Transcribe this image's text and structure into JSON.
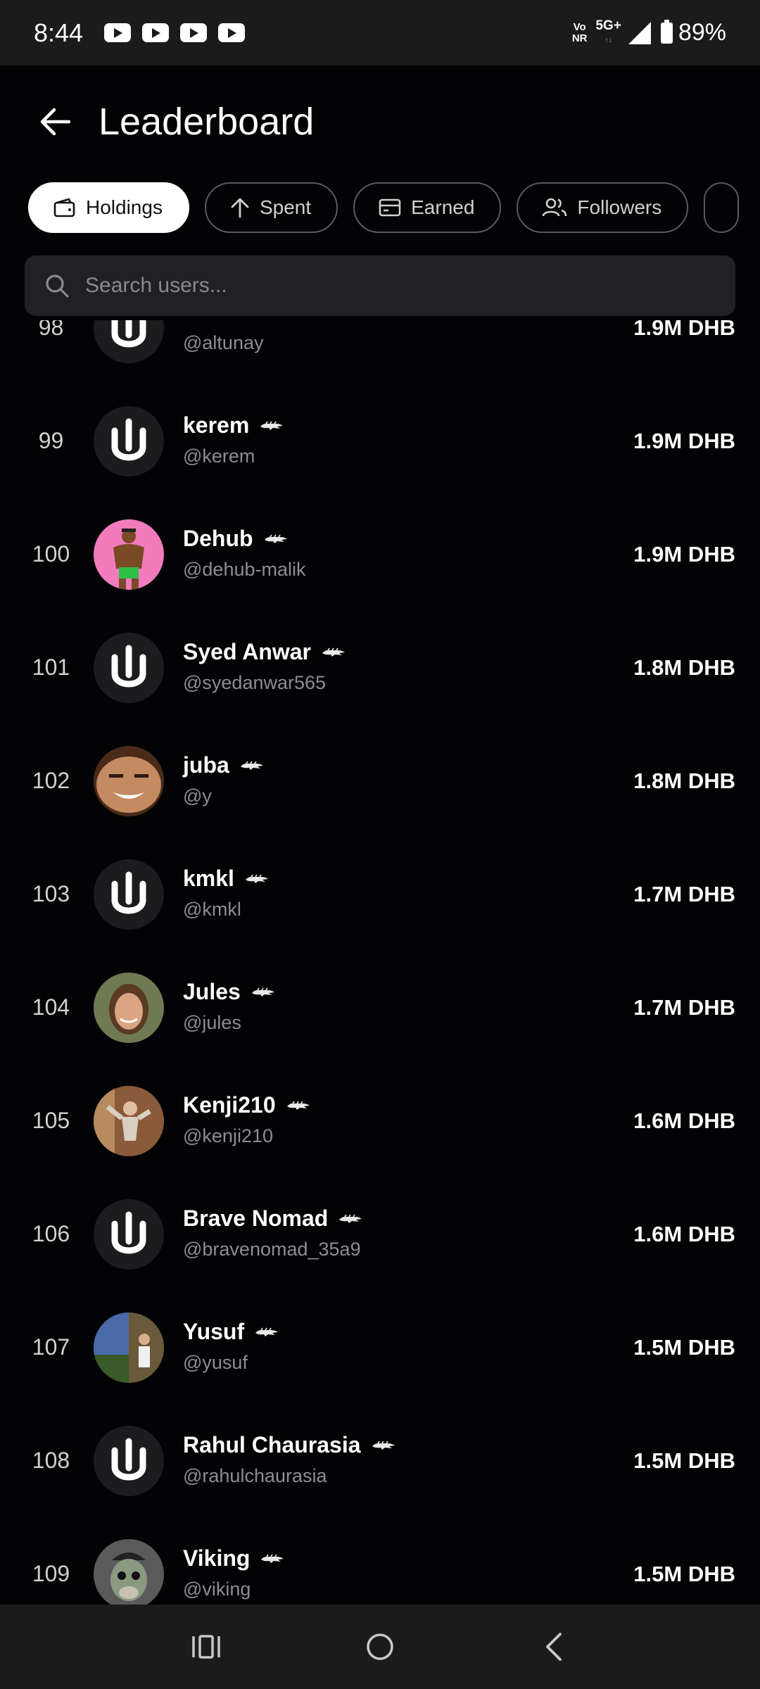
{
  "status": {
    "time": "8:44",
    "volte_top": "Vo",
    "volte_bottom": "NR",
    "network": "5G+",
    "battery": "89%",
    "notification_icons": [
      "youtube-icon",
      "youtube-icon",
      "youtube-icon",
      "youtube-icon"
    ]
  },
  "header": {
    "title": "Leaderboard"
  },
  "filters": [
    {
      "label": "Holdings",
      "icon": "wallet-icon",
      "active": true
    },
    {
      "label": "Spent",
      "icon": "arrow-up-icon",
      "active": false
    },
    {
      "label": "Earned",
      "icon": "card-icon",
      "active": false
    },
    {
      "label": "Followers",
      "icon": "users-icon",
      "active": false
    }
  ],
  "search": {
    "placeholder": "Search users..."
  },
  "entries": [
    {
      "rank": "98",
      "name": "",
      "handle": "@altunay",
      "amount": "1.9M DHB",
      "avatar": "default"
    },
    {
      "rank": "99",
      "name": "kerem",
      "handle": "@kerem",
      "amount": "1.9M DHB",
      "avatar": "default"
    },
    {
      "rank": "100",
      "name": "Dehub",
      "handle": "@dehub-malik",
      "amount": "1.9M DHB",
      "avatar": "pink-figure"
    },
    {
      "rank": "101",
      "name": "Syed Anwar",
      "handle": "@syedanwar565",
      "amount": "1.8M DHB",
      "avatar": "default"
    },
    {
      "rank": "102",
      "name": "juba",
      "handle": "@y",
      "amount": "1.8M DHB",
      "avatar": "face-photo"
    },
    {
      "rank": "103",
      "name": "kmkl",
      "handle": "@kmkl",
      "amount": "1.7M DHB",
      "avatar": "default"
    },
    {
      "rank": "104",
      "name": "Jules",
      "handle": "@jules",
      "amount": "1.7M DHB",
      "avatar": "woman-photo"
    },
    {
      "rank": "105",
      "name": "Kenji210",
      "handle": "@kenji210",
      "amount": "1.6M DHB",
      "avatar": "dab-photo"
    },
    {
      "rank": "106",
      "name": "Brave Nomad",
      "handle": "@bravenomad_35a9",
      "amount": "1.6M DHB",
      "avatar": "default"
    },
    {
      "rank": "107",
      "name": "Yusuf",
      "handle": "@yusuf",
      "amount": "1.5M DHB",
      "avatar": "outdoor-photo"
    },
    {
      "rank": "108",
      "name": "Rahul Chaurasia",
      "handle": "@rahulchaurasia",
      "amount": "1.5M DHB",
      "avatar": "default"
    },
    {
      "rank": "109",
      "name": "Viking",
      "handle": "@viking",
      "amount": "1.5M DHB",
      "avatar": "ape-cartoon"
    }
  ],
  "badge_icon": "crocodile-icon",
  "colors": {
    "background": "#030305",
    "chip_active": "#ffffff",
    "search_bg": "#212124",
    "muted_text": "#8d8d92"
  }
}
